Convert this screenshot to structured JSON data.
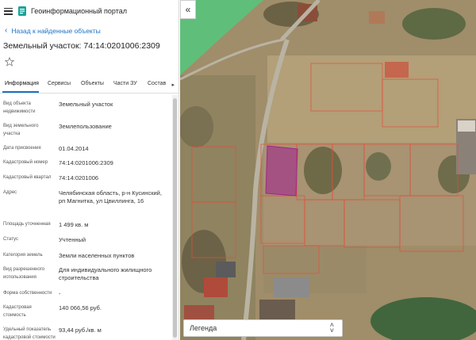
{
  "app": {
    "title": "Геоинформационный портал"
  },
  "nav": {
    "back_label": "Назад к найденные объекты"
  },
  "parcel": {
    "title": "Земельный участок: 74:14:0201006:2309"
  },
  "tabs": [
    {
      "label": "Информация"
    },
    {
      "label": "Сервисы"
    },
    {
      "label": "Объекты"
    },
    {
      "label": "Части ЗУ"
    },
    {
      "label": "Состав"
    }
  ],
  "properties": [
    {
      "label": "Вид объекта недвижимости",
      "value": "Земельный участок"
    },
    {
      "label": "Вид земельного участка",
      "value": "Землепользование"
    },
    {
      "label": "Дата присвоения",
      "value": "01.04.2014"
    },
    {
      "label": "Кадастровый номер",
      "value": "74:14:0201006:2309"
    },
    {
      "label": "Кадастровый квартал",
      "value": "74:14:0201006"
    },
    {
      "label": "Адрес",
      "value": "Челябинская область, р-н Кусинский, рп Магнитка, ул Цвиллинга, 16"
    },
    {
      "label": "Площадь уточненная",
      "value": "1 499 кв. м"
    },
    {
      "label": "Статус",
      "value": "Учтенный"
    },
    {
      "label": "Категория земель",
      "value": "Земли населенных пунктов"
    },
    {
      "label": "Вид разрешенного использования",
      "value": "Для индивидуального жилищного строительства"
    },
    {
      "label": "Форма собственности",
      "value": "-"
    },
    {
      "label": "Кадастровая стоимость",
      "value": "140 066,56 руб."
    },
    {
      "label": "Удельный показатель кадастровой стоимости",
      "value": "93,44 руб./кв. м"
    }
  ],
  "map": {
    "legend_label": "Легенда",
    "collapse_glyph": "«",
    "selected_color": "#a0278c",
    "parcel_border_color": "#e0503a"
  }
}
